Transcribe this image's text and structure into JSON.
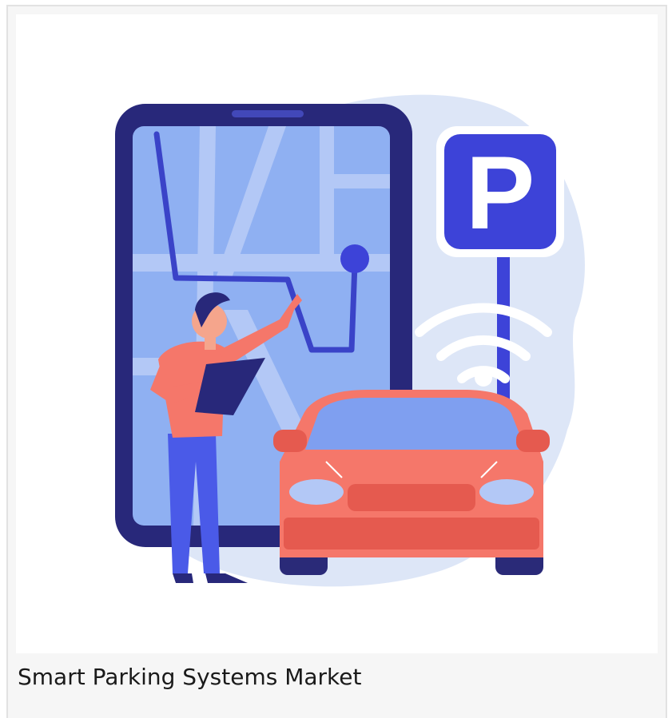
{
  "card": {
    "caption": "Smart Parking Systems Market",
    "illustration_icon": "smart-parking-illustration",
    "parking_sign_letter": "P"
  },
  "colors": {
    "phone_frame": "#28287a",
    "map_background": "#8fb0f2",
    "route_line": "#3a43c8",
    "parking_sign": "#3d43d8",
    "car_body": "#f5776a",
    "person_shirt": "#f5776a",
    "person_pants": "#4a5ae8",
    "blob_background": "#dde6f7"
  }
}
